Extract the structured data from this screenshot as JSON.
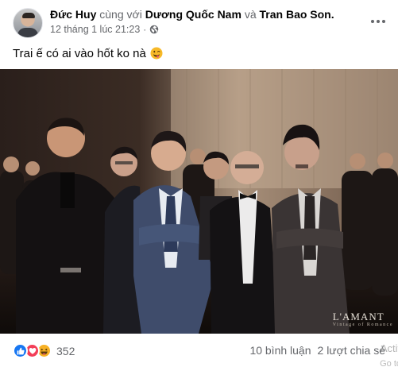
{
  "post": {
    "author": "Đức Huy",
    "with_text": "cùng với",
    "tagged_1": "Dương Quốc Nam",
    "and_text": "và",
    "tagged_2": "Tran Bao Son.",
    "timestamp": "12 tháng 1 lúc 21:23",
    "separator": "·",
    "privacy_icon": "globe-icon",
    "text": "Trai ế có ai vào hốt ko nà",
    "text_emoji": "winking-tongue-emoji"
  },
  "photo": {
    "watermark": "L'AMANT",
    "watermark_sub": "Vintage of Romance"
  },
  "footer": {
    "reactions": [
      "like-icon",
      "love-icon",
      "haha-icon"
    ],
    "reaction_count": "352",
    "comments": "10 bình luận",
    "shares": "2 lượt chia sẻ"
  },
  "overlay": {
    "activate": "Activ",
    "activate_sub": "Go to"
  },
  "colors": {
    "secondary_text": "#65676b",
    "like_blue": "#1877f2",
    "love_red": "#f33e58",
    "haha_yellow": "#f7b125"
  }
}
